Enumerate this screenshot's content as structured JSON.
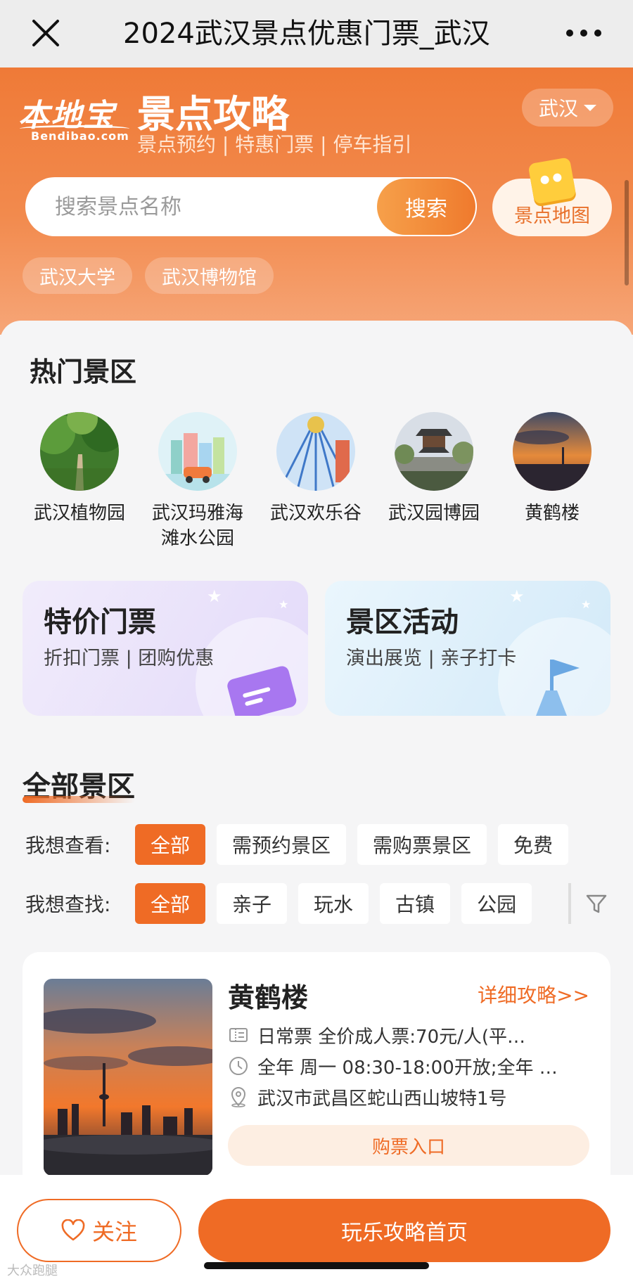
{
  "topbar": {
    "title": "2024武汉景点优惠门票_武汉",
    "close_icon": "close-icon",
    "more_icon": "more-icon"
  },
  "header": {
    "logo_main": "本地宝",
    "logo_sub": "Bendibao.com",
    "title": "景点攻略",
    "subtitle": "景点预约 | 特惠门票 | 停车指引",
    "city": "武汉",
    "search_placeholder": "搜索景点名称",
    "search_button": "搜索",
    "map_button": "景点地图",
    "chips": [
      "武汉大学",
      "武汉博物馆"
    ]
  },
  "hot": {
    "title": "热门景区",
    "items": [
      {
        "label": "武汉植物园"
      },
      {
        "label_line1": "武汉玛雅海",
        "label_line2": "滩水公园"
      },
      {
        "label": "武汉欢乐谷"
      },
      {
        "label": "武汉园博园"
      },
      {
        "label": "黄鹤楼"
      }
    ]
  },
  "promos": [
    {
      "title": "特价门票",
      "subtitle": "折扣门票 | 团购优惠"
    },
    {
      "title": "景区活动",
      "subtitle": "演出展览 | 亲子打卡"
    }
  ],
  "all": {
    "title": "全部景区",
    "view_label": "我想查看:",
    "view_options": [
      "全部",
      "需预约景区",
      "需购票景区",
      "免费"
    ],
    "find_label": "我想查找:",
    "find_options": [
      "全部",
      "亲子",
      "玩水",
      "古镇",
      "公园"
    ]
  },
  "spot": {
    "name": "黄鹤楼",
    "link": "详细攻略>>",
    "ticket": "日常票 全价成人票:70元/人(平…",
    "hours": "全年 周一 08:30-18:00开放;全年 …",
    "address": "武汉市武昌区蛇山西山坡特1号",
    "buy": "购票入口"
  },
  "bottom": {
    "follow": "关注",
    "home": "玩乐攻略首页",
    "watermark": "大众跑腿"
  },
  "colors": {
    "accent": "#ef6b25",
    "header_top": "#ef7a37",
    "promo_left": "#e3dafa",
    "promo_right": "#d2e9f8"
  }
}
